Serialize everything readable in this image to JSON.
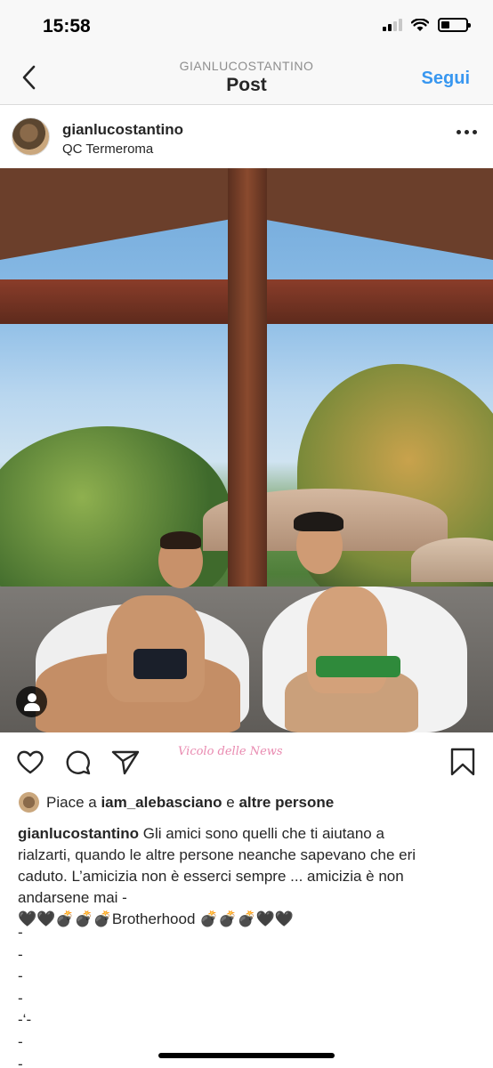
{
  "status": {
    "time": "15:58",
    "battery_level": 0.35
  },
  "nav": {
    "subtitle": "GIANLUCOSTANTINO",
    "title": "Post",
    "follow_label": "Segui",
    "back_icon": "chevron-left-icon"
  },
  "post": {
    "username": "gianlucostantino",
    "location": "QC Termeroma",
    "more_icon": "ellipsis-icon"
  },
  "actions": {
    "like_icon": "heart-icon",
    "comment_icon": "comment-icon",
    "share_icon": "paper-plane-icon",
    "save_icon": "bookmark-icon",
    "watermark_text": "Vicolo delle News"
  },
  "likes": {
    "prefix": "Piace a",
    "user": "iam_alebasciano",
    "joiner": "e",
    "others": "altre persone"
  },
  "caption": {
    "user": "gianlucostantino",
    "line1": " Gli amici sono quelli che ti aiutano a",
    "line2": "rialzarti, quando le altre persone neanche sapevano che eri",
    "line3": "caduto. L’amicizia non è esserci sempre ... amicizia è non",
    "line4": "andarsene mai -",
    "line5": "🖤🖤💣💣💣Brotherhood 💣💣💣🖤🖤",
    "dashes": [
      "-",
      "-",
      "-",
      "-",
      "-‘-",
      "-",
      "-"
    ]
  },
  "colors": {
    "link": "#3897f0",
    "text": "#262626",
    "muted": "#8e8e8e"
  }
}
